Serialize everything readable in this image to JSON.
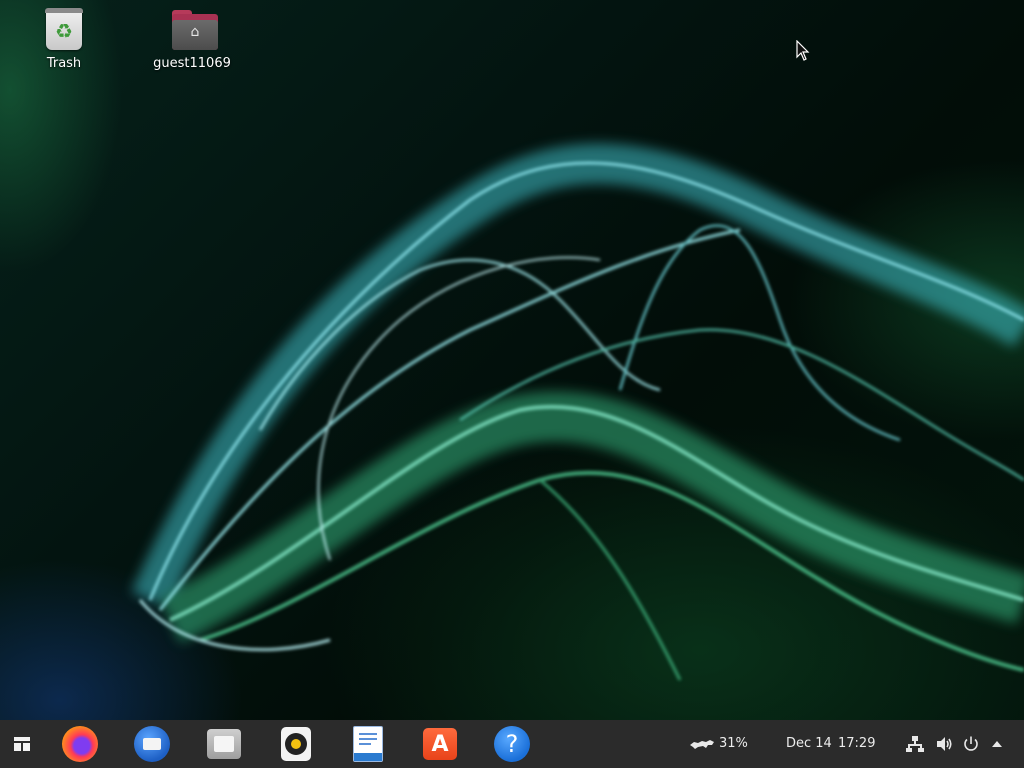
{
  "desktop": {
    "icons": [
      {
        "label": "Trash",
        "icon": "trash-icon"
      },
      {
        "label": "guest11069",
        "icon": "home-folder-icon"
      }
    ]
  },
  "taskbar": {
    "start_icon": "start-menu-icon",
    "apps": [
      {
        "name": "firefox",
        "icon": "firefox-icon"
      },
      {
        "name": "thunderbird",
        "icon": "thunderbird-icon"
      },
      {
        "name": "files",
        "icon": "files-icon"
      },
      {
        "name": "rhythmbox",
        "icon": "rhythmbox-icon"
      },
      {
        "name": "libreoffice-writer",
        "icon": "writer-icon"
      },
      {
        "name": "software-center",
        "icon": "software-icon"
      },
      {
        "name": "help",
        "icon": "help-icon"
      }
    ],
    "tray": {
      "battery_percent": "31%",
      "date": "Dec 14",
      "time": "17:29",
      "icons": [
        "network-icon",
        "volume-icon",
        "power-icon",
        "chevron-up-icon"
      ]
    }
  },
  "colors": {
    "taskbar_bg": "#2b2b2b",
    "wallpaper_smoke": "#5fd1d8",
    "wallpaper_green": "#2fbf7a"
  }
}
